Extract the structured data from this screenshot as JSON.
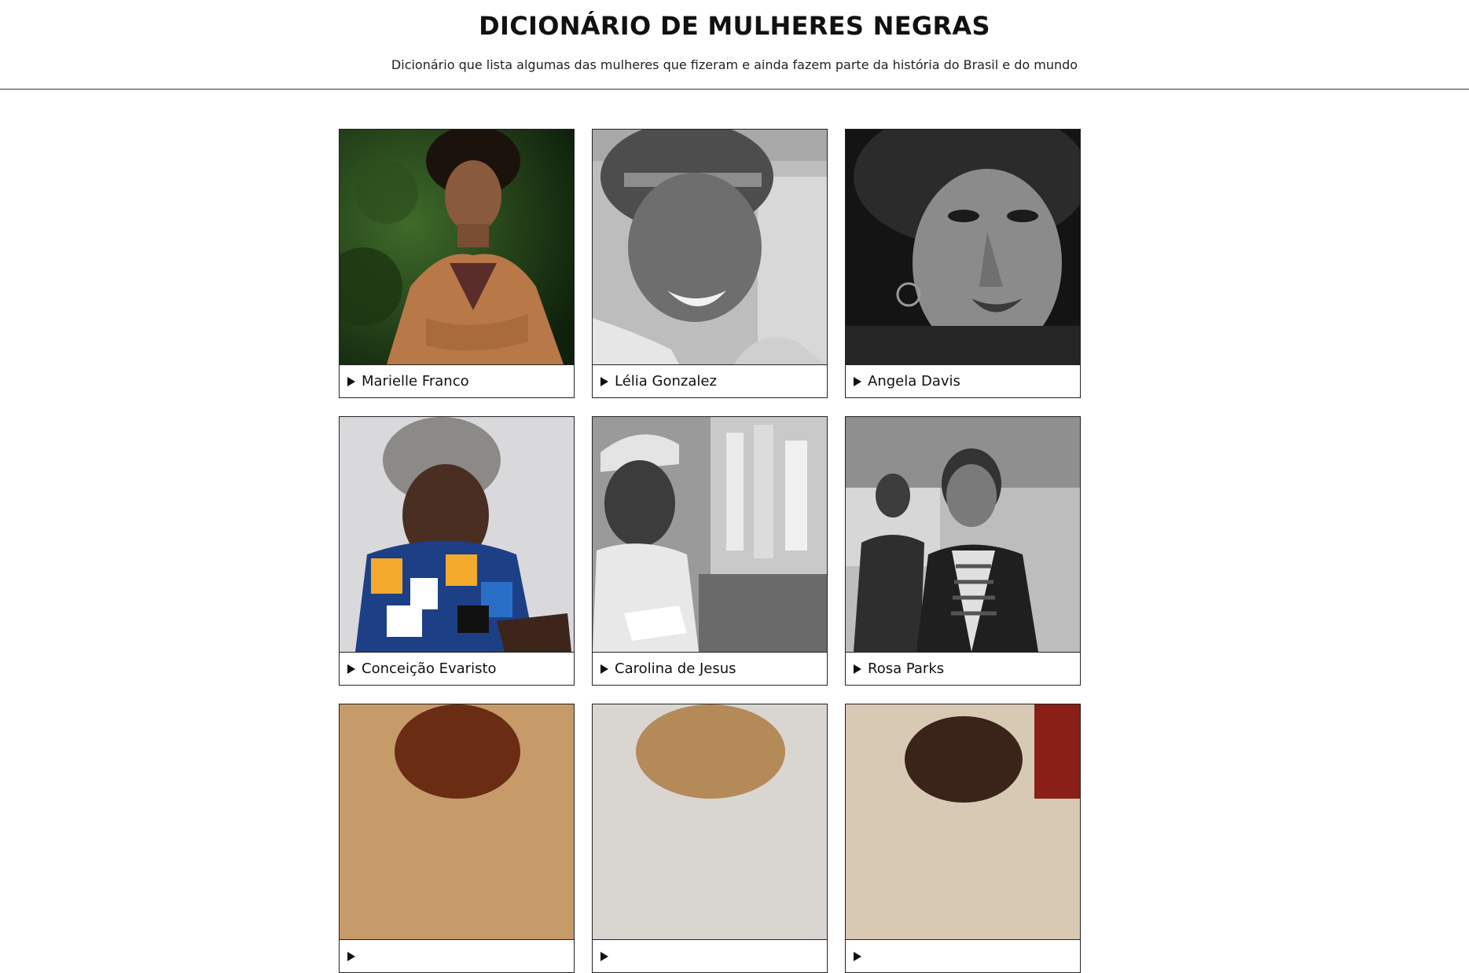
{
  "header": {
    "title": "DICIONÁRIO DE MULHERES NEGRAS",
    "subtitle": "Dicionário que lista algumas das mulheres que fizeram e ainda fazem parte da história do Brasil e do mundo"
  },
  "cards": [
    {
      "name": "Marielle Franco"
    },
    {
      "name": "Lélia Gonzalez"
    },
    {
      "name": "Angela Davis"
    },
    {
      "name": "Conceição Evaristo"
    },
    {
      "name": "Carolina de Jesus"
    },
    {
      "name": "Rosa Parks"
    },
    {
      "name": ""
    },
    {
      "name": ""
    },
    {
      "name": ""
    }
  ],
  "icons": {
    "expand": "triangle-right-icon"
  },
  "colors": {
    "text": "#111111",
    "border": "#222222",
    "background": "#ffffff"
  }
}
